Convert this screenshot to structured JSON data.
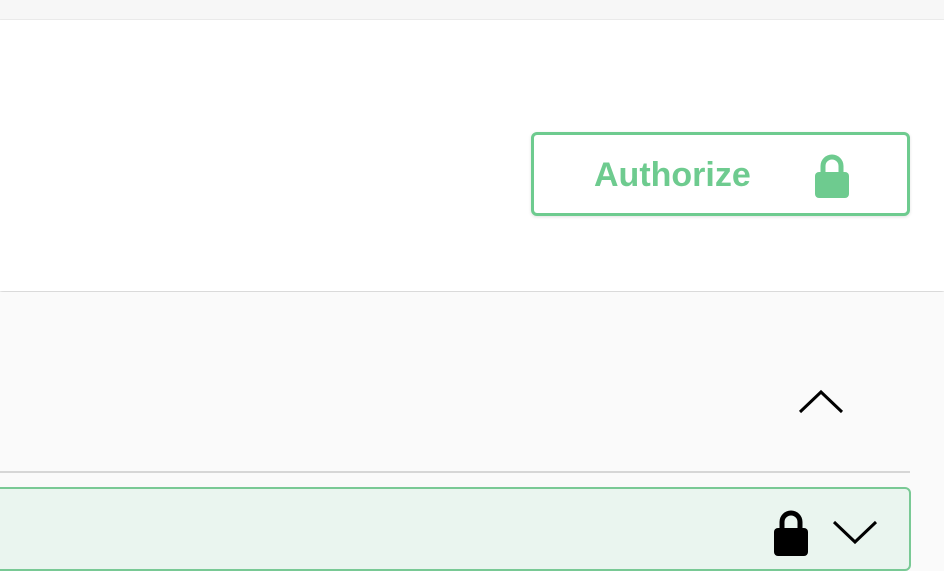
{
  "header": {
    "authorize_button": {
      "label": "Authorize",
      "icon": "lock-icon",
      "color": "#6ecb8f"
    }
  },
  "section": {
    "collapse_icon": "chevron-up-icon"
  },
  "operation": {
    "background": "#eaf5ef",
    "border": "#79c995",
    "lock_icon": "lock-icon",
    "expand_icon": "chevron-down-icon"
  }
}
